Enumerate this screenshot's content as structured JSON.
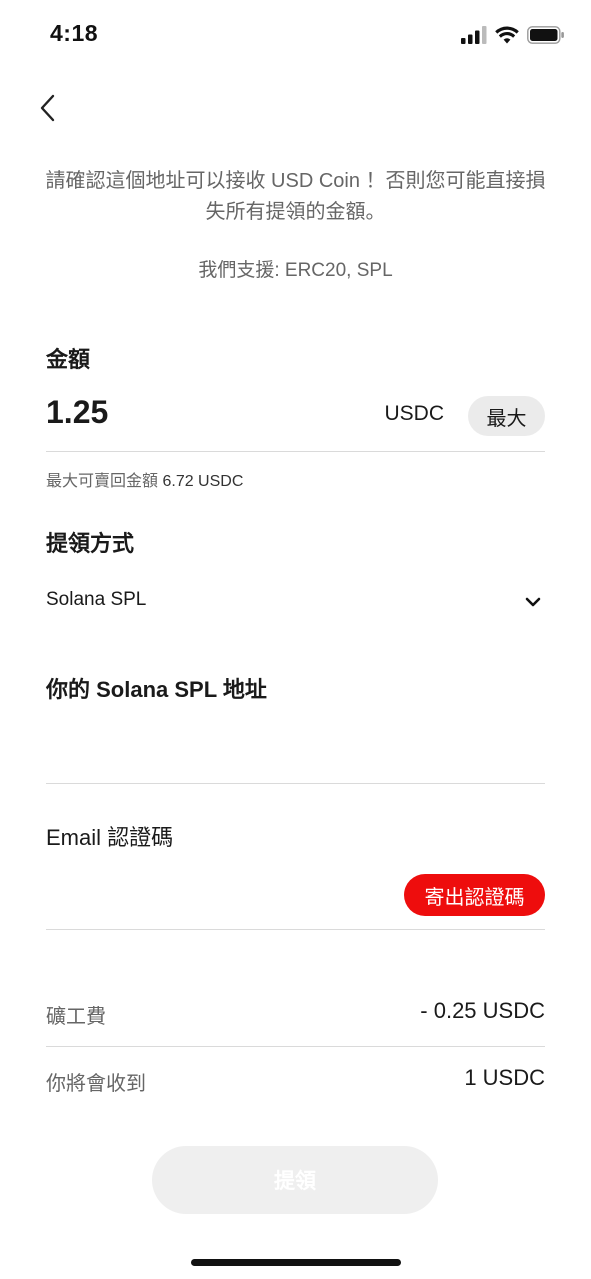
{
  "status_bar": {
    "time": "4:18"
  },
  "notice_text": "請確認這個地址可以接收 USD Coin ！否則您可能直接損失所有提領的金額。",
  "support_text": "我們支援: ERC20, SPL",
  "amount": {
    "label": "金額",
    "value": "1.25",
    "unit": "USDC",
    "max_button": "最大",
    "max_hint_prefix": "最大可賣回金額",
    "max_hint_value": "6.72 USDC"
  },
  "method": {
    "label": "提領方式",
    "selected": "Solana SPL"
  },
  "address": {
    "label": "你的 Solana SPL 地址",
    "value": "",
    "placeholder": ""
  },
  "email_code": {
    "label": "Email 認證碼",
    "value": "",
    "placeholder": "",
    "send_button": "寄出認證碼"
  },
  "fee": {
    "label": "礦工費",
    "value": "- 0.25 USDC"
  },
  "receive": {
    "label": "你將會收到",
    "value": "1 USDC"
  },
  "submit_button": "提領",
  "colors": {
    "accent_red": "#ee0d0d",
    "disabled_button": "#efefef",
    "secondary_text": "#666666"
  }
}
